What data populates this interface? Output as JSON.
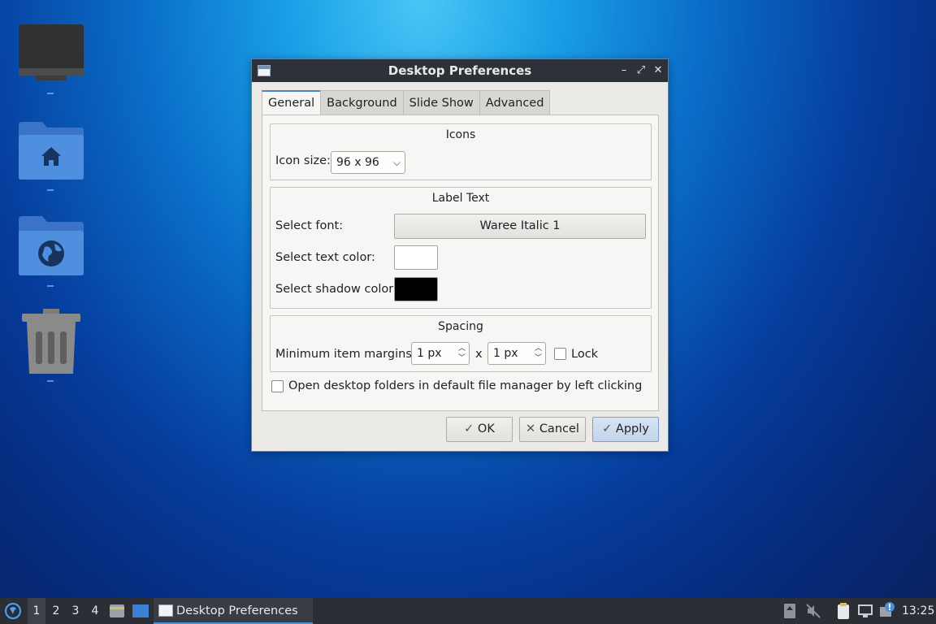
{
  "desktop": {
    "icons": [
      "computer-icon",
      "home-folder-icon",
      "network-folder-icon",
      "trash-icon"
    ]
  },
  "window": {
    "title": "Desktop Preferences",
    "controls": {
      "minimize": "–",
      "maximize": "⤢",
      "close": "✕"
    },
    "tabs": [
      "General",
      "Background",
      "Slide Show",
      "Advanced"
    ],
    "active_tab": "General",
    "icons_group": {
      "title": "Icons",
      "icon_size_label": "Icon size:",
      "icon_size_value": "96 x 96"
    },
    "label_text_group": {
      "title": "Label Text",
      "font_label": "Select font:",
      "font_value": "Waree Italic 1",
      "text_color_label": "Select text color:",
      "text_color": "#ffffff",
      "shadow_color_label": "Select shadow color:",
      "shadow_color": "#000000"
    },
    "spacing_group": {
      "title": "Spacing",
      "margins_label": "Minimum item margins:",
      "margin_x": "1 px",
      "separator": "x",
      "margin_y": "1 px",
      "lock_label": "Lock",
      "lock_checked": false
    },
    "open_folders_label": "Open desktop folders in default file manager by left clicking",
    "open_folders_checked": false,
    "buttons": {
      "ok": "OK",
      "cancel": "Cancel",
      "apply": "Apply"
    }
  },
  "taskbar": {
    "workspaces": [
      "1",
      "2",
      "3",
      "4"
    ],
    "active_workspace": "1",
    "task_title": "Desktop Preferences",
    "clock": "13:25"
  },
  "colors": {
    "accent": "#4b85c8",
    "titlebar": "#2e3238",
    "taskbar": "#2b2f35"
  }
}
